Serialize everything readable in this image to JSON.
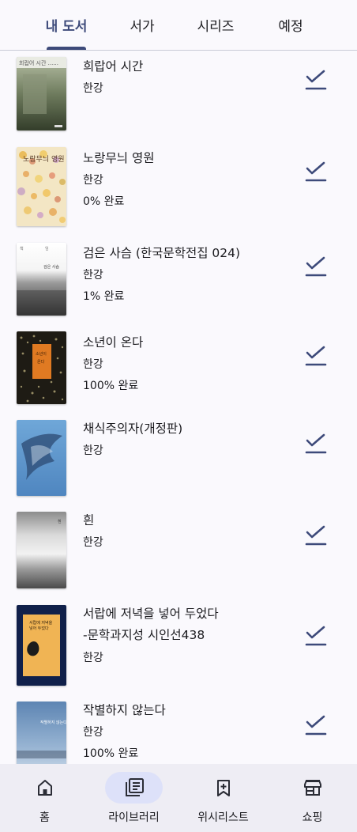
{
  "tabs": [
    {
      "label": "내 도서",
      "active": true
    },
    {
      "label": "서가",
      "active": false
    },
    {
      "label": "시리즈",
      "active": false
    },
    {
      "label": "예정",
      "active": false
    }
  ],
  "books": [
    {
      "title": "희랍어 시간",
      "author": "한강",
      "progress": ""
    },
    {
      "title": "노랑무늬 영원",
      "author": "한강",
      "progress": "0% 완료"
    },
    {
      "title": "검은 사슴 (한국문학전집 024)",
      "author": "한강",
      "progress": "1% 완료"
    },
    {
      "title": "소년이 온다",
      "author": "한강",
      "progress": "100% 완료"
    },
    {
      "title": "채식주의자(개정판)",
      "author": "한강",
      "progress": ""
    },
    {
      "title": "흰",
      "author": "한강",
      "progress": ""
    },
    {
      "title": "서랍에 저녁을 넣어 두었다",
      "subtitle": "-문학과지성 시인선438",
      "author": "한강",
      "progress": ""
    },
    {
      "title": "작별하지 않는다",
      "author": "한강",
      "progress": "100% 완료"
    }
  ],
  "nav": [
    {
      "label": "홈",
      "icon": "home-icon",
      "active": false
    },
    {
      "label": "라이브러리",
      "icon": "library-icon",
      "active": true
    },
    {
      "label": "위시리스트",
      "icon": "wishlist-icon",
      "active": false
    },
    {
      "label": "쇼핑",
      "icon": "store-icon",
      "active": false
    }
  ],
  "colors": {
    "accent": "#3d4a7a",
    "background": "#faf9fd",
    "nav_background": "#eeedf4",
    "nav_active_pill": "#dde1f9"
  }
}
